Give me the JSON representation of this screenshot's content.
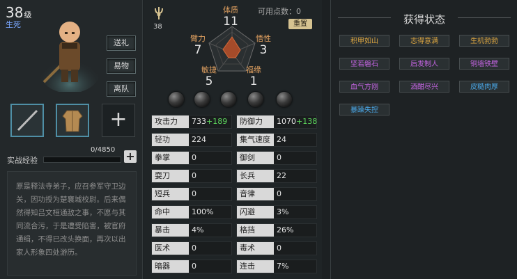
{
  "character": {
    "level": "38",
    "level_suffix": "级",
    "stance": "生死",
    "buttons": {
      "gift": "送礼",
      "trade": "易物",
      "leave": "离队"
    },
    "exp_label": "实战经验",
    "exp_value": "0/4850",
    "exp_progress": 0,
    "exp_add": "+",
    "slot_add": "+",
    "bio": "原是释法寺弟子，应召参军守卫边关，因功授为楚襄城校尉。后来偶然得知吕文桓通敌之事，不愿与其同流合污，于是遭受陷害，被官府通缉，不得已改头换面，再次以出家人形象四处游历。"
  },
  "attributes": {
    "top_icon_value": "38",
    "available_points_label": "可用点数：",
    "available_points": "0",
    "reset_label": "重置",
    "items": [
      {
        "key": "tizhi",
        "name": "体质",
        "value": "11"
      },
      {
        "key": "wuxing",
        "name": "悟性",
        "value": "3"
      },
      {
        "key": "fuyuan",
        "name": "福缘",
        "value": "1"
      },
      {
        "key": "minjie",
        "name": "敏捷",
        "value": "5"
      },
      {
        "key": "biili",
        "name": "臂力",
        "value": "7"
      }
    ]
  },
  "stats": {
    "left": [
      {
        "name": "攻击力",
        "value": "733",
        "bonus": "+189"
      },
      {
        "name": "轻功",
        "value": "224",
        "bonus": ""
      },
      {
        "name": "拳掌",
        "value": "0",
        "bonus": ""
      },
      {
        "name": "耍刀",
        "value": "0",
        "bonus": ""
      },
      {
        "name": "短兵",
        "value": "0",
        "bonus": ""
      },
      {
        "name": "命中",
        "value": "100%",
        "bonus": ""
      },
      {
        "name": "暴击",
        "value": "4%",
        "bonus": ""
      },
      {
        "name": "医术",
        "value": "0",
        "bonus": ""
      },
      {
        "name": "暗器",
        "value": "0",
        "bonus": ""
      }
    ],
    "right": [
      {
        "name": "防御力",
        "value": "1070",
        "bonus": "+138"
      },
      {
        "name": "集气速度",
        "value": "24",
        "bonus": ""
      },
      {
        "name": "御剑",
        "value": "0",
        "bonus": ""
      },
      {
        "name": "长兵",
        "value": "22",
        "bonus": ""
      },
      {
        "name": "音律",
        "value": "0",
        "bonus": ""
      },
      {
        "name": "闪避",
        "value": "3%",
        "bonus": ""
      },
      {
        "name": "格挡",
        "value": "26%",
        "bonus": ""
      },
      {
        "name": "毒术",
        "value": "0",
        "bonus": ""
      },
      {
        "name": "连击",
        "value": "7%",
        "bonus": ""
      }
    ]
  },
  "status_panel": {
    "title": "获得状态",
    "tags": [
      {
        "label": "积甲如山",
        "color": "#d9a441"
      },
      {
        "label": "志得意满",
        "color": "#d9a441"
      },
      {
        "label": "生机勃勃",
        "color": "#d9a441"
      },
      {
        "label": "坚若磐石",
        "color": "#c264e0"
      },
      {
        "label": "后发制人",
        "color": "#c264e0"
      },
      {
        "label": "铜墙铁壁",
        "color": "#c264e0"
      },
      {
        "label": "血气方刚",
        "color": "#c264e0"
      },
      {
        "label": "酒酣尽兴",
        "color": "#c264e0"
      },
      {
        "label": "皮糙肉厚",
        "color": "#4aa8e8"
      },
      {
        "label": "暴躁失控",
        "color": "#4aa8e8"
      }
    ]
  },
  "colors": {
    "accent": "#e0a060",
    "bonus": "#5cd65c",
    "stance": "#7aa7ff"
  }
}
